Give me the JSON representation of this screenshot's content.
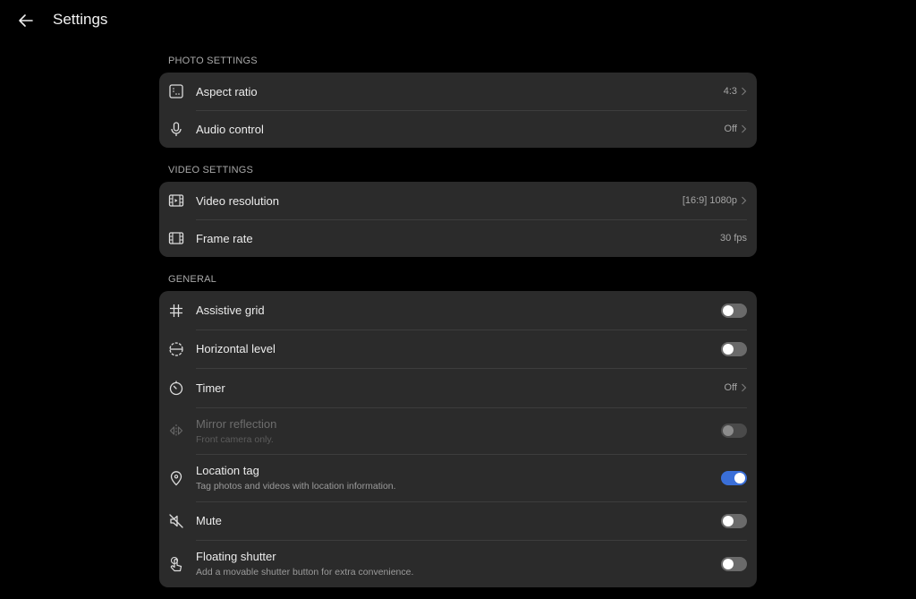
{
  "header": {
    "title": "Settings",
    "back_icon": "back-arrow-icon"
  },
  "sections": {
    "photo": {
      "title": "PHOTO SETTINGS",
      "aspect_ratio": {
        "label": "Aspect ratio",
        "value": "4:3",
        "icon": "aspect-ratio-icon"
      },
      "audio_control": {
        "label": "Audio control",
        "value": "Off",
        "icon": "microphone-icon"
      }
    },
    "video": {
      "title": "VIDEO SETTINGS",
      "resolution": {
        "label": "Video resolution",
        "value": "[16:9] 1080p",
        "icon": "film-icon"
      },
      "frame_rate": {
        "label": "Frame rate",
        "value": "30 fps",
        "icon": "film-icon"
      }
    },
    "general": {
      "title": "GENERAL",
      "assistive_grid": {
        "label": "Assistive grid",
        "on": false,
        "icon": "grid-icon"
      },
      "horizontal_level": {
        "label": "Horizontal level",
        "on": false,
        "icon": "level-icon"
      },
      "timer": {
        "label": "Timer",
        "value": "Off",
        "icon": "timer-icon"
      },
      "mirror_reflection": {
        "label": "Mirror reflection",
        "sub": "Front camera only.",
        "on": false,
        "disabled": true,
        "icon": "mirror-icon"
      },
      "location_tag": {
        "label": "Location tag",
        "sub": "Tag photos and videos with location information.",
        "on": true,
        "icon": "location-pin-icon"
      },
      "mute": {
        "label": "Mute",
        "on": false,
        "icon": "mute-icon"
      },
      "floating_shutter": {
        "label": "Floating shutter",
        "sub": "Add a movable shutter button for extra convenience.",
        "on": false,
        "icon": "touch-hand-icon"
      }
    }
  },
  "colors": {
    "background": "#000000",
    "card": "#2b2b2b",
    "accent": "#3a6fd8"
  }
}
